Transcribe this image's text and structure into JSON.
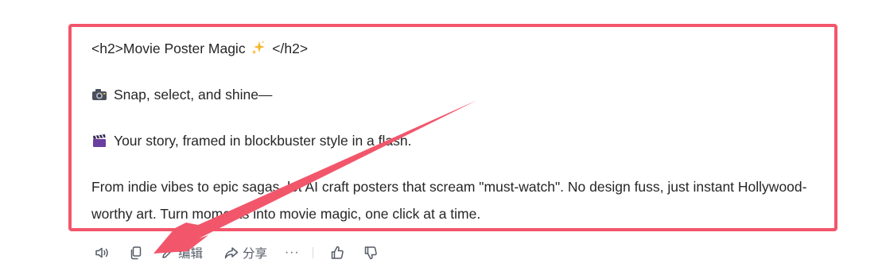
{
  "message": {
    "line1_before": "<h2>Movie Poster Magic ",
    "line1_after": " </h2>",
    "line2": "Snap, select, and shine—",
    "line3": "Your story, framed in blockbuster style in a flash.",
    "line4": "From indie vibes to epic sagas, let AI craft posters that scream \"must-watch\". No design fuss, just instant Hollywood-worthy art. Turn moments into movie magic, one click at a time."
  },
  "toolbar": {
    "edit_label": "编辑",
    "share_label": "分享",
    "more_label": "···"
  },
  "annotation": {
    "highlight_color": "#f2566b",
    "arrow_color": "#f2566b"
  },
  "icons": [
    "sparkle-icon",
    "camera-icon",
    "clapperboard-icon",
    "speaker-icon",
    "copy-icon",
    "edit-icon",
    "share-icon",
    "thumbs-up-icon",
    "thumbs-down-icon"
  ]
}
